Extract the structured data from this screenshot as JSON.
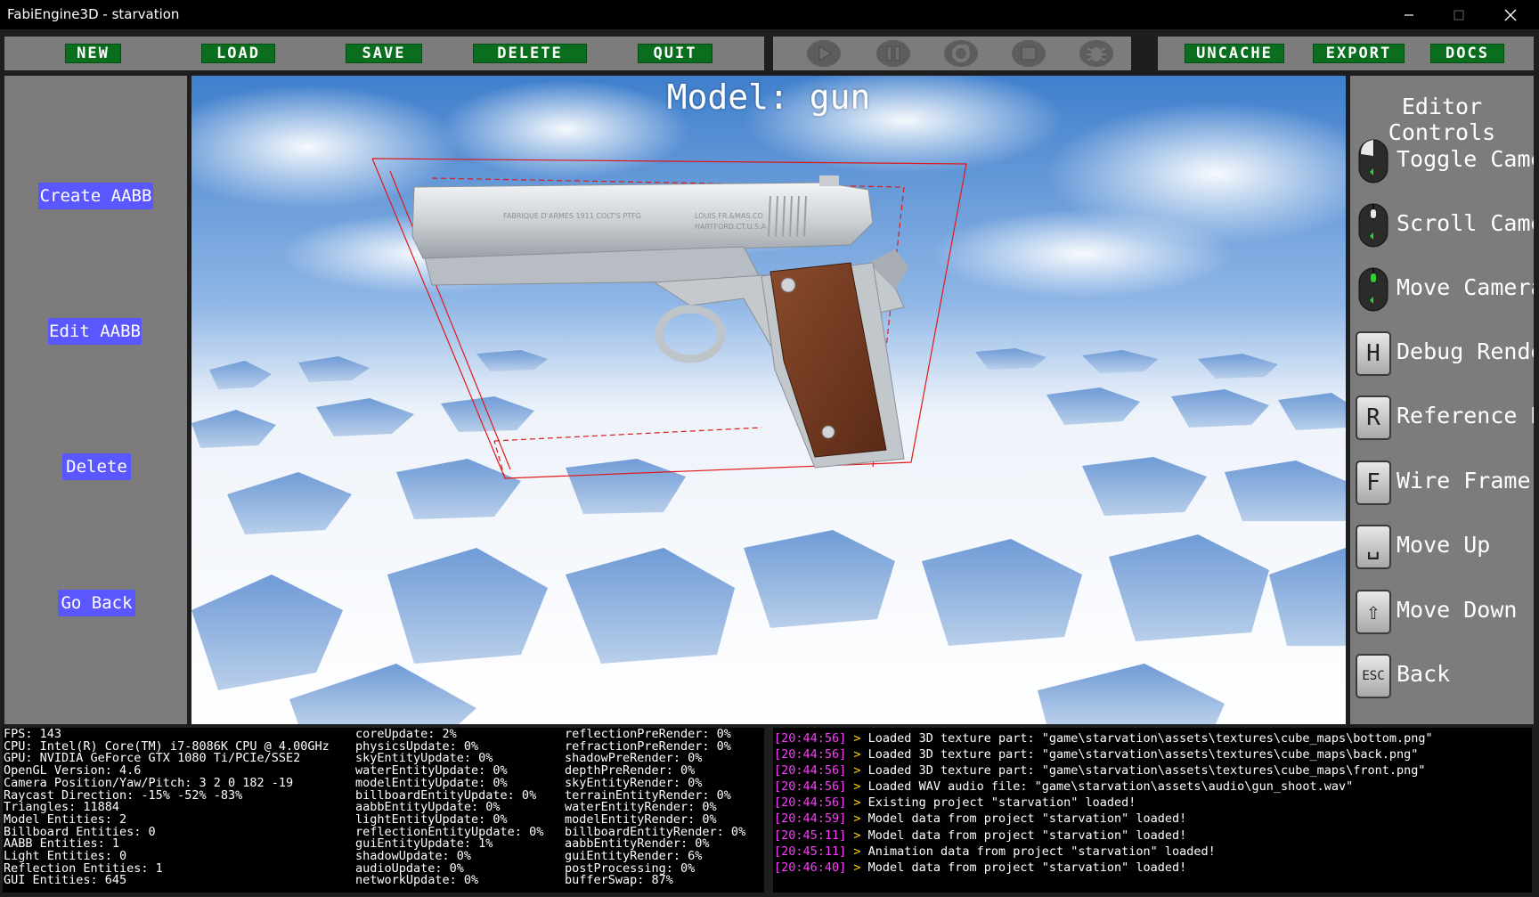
{
  "window": {
    "title": "FabiEngine3D - starvation",
    "controls": [
      "minimize-icon",
      "maximize-icon",
      "close-icon"
    ]
  },
  "menu": {
    "left": [
      "NEW",
      "LOAD",
      "SAVE",
      "DELETE",
      "QUIT"
    ],
    "playback_icons": [
      "play-icon",
      "pause-icon",
      "restart-icon",
      "stop-icon",
      "debug-bug-icon"
    ],
    "right": [
      "UNCACHE",
      "EXPORT",
      "DOCS"
    ]
  },
  "left_panel": {
    "buttons": [
      "Create AABB",
      "Edit AABB",
      "Delete",
      "Go Back"
    ]
  },
  "viewport": {
    "title": "Model: gun",
    "model_markings": [
      "FABRIQUE D'ARMES 1911 COLT'S PTFG",
      "LOUIS FR.&MAS.CO",
      "HARTFORD.CT.U.S.A"
    ]
  },
  "controls": {
    "title": "Editor Controls",
    "items": [
      {
        "icon": "mouse-left-click-icon",
        "label": "Toggle Camera"
      },
      {
        "icon": "mouse-scroll-icon",
        "label": "Scroll Camera"
      },
      {
        "icon": "mouse-middle-click-icon",
        "label": "Move Camera"
      },
      {
        "icon": "key-h-icon",
        "key": "H",
        "label": "Debug Render"
      },
      {
        "icon": "key-r-icon",
        "key": "R",
        "label": "Reference Box"
      },
      {
        "icon": "key-f-icon",
        "key": "F",
        "label": "Wire Frame"
      },
      {
        "icon": "key-space-icon",
        "key": "␣",
        "label": "Move Up"
      },
      {
        "icon": "key-shift-icon",
        "key": "⇧",
        "label": "Move Down"
      },
      {
        "icon": "key-esc-icon",
        "key": "ESC",
        "label": "Back"
      }
    ]
  },
  "stats": {
    "col1": [
      "FPS: 143",
      "CPU: Intel(R) Core(TM) i7-8086K CPU @ 4.00GHz",
      "GPU: NVIDIA GeForce GTX 1080 Ti/PCIe/SSE2",
      "OpenGL Version: 4.6",
      "Camera Position/Yaw/Pitch: 3 2 0 182 -19",
      "Raycast Direction: -15% -52% -83%",
      "Triangles: 11884",
      "Model Entities: 2",
      "Billboard Entities: 0",
      "AABB Entities: 1",
      "Light Entities: 0",
      "Reflection Entities: 1",
      "GUI Entities: 645"
    ],
    "col2": [
      "coreUpdate: 2%",
      "physicsUpdate: 0%",
      "skyEntityUpdate: 0%",
      "waterEntityUpdate: 0%",
      "modelEntityUpdate: 0%",
      "billboardEntityUpdate: 0%",
      "aabbEntityUpdate: 0%",
      "lightEntityUpdate: 0%",
      "reflectionEntityUpdate: 0%",
      "guiEntityUpdate: 1%",
      "shadowUpdate: 0%",
      "audioUpdate: 0%",
      "networkUpdate: 0%"
    ],
    "col3": [
      "reflectionPreRender: 0%",
      "refractionPreRender: 0%",
      "shadowPreRender: 0%",
      "depthPreRender: 0%",
      "skyEntityRender: 0%",
      "terrainEntityRender: 0%",
      "waterEntityRender: 0%",
      "modelEntityRender: 0%",
      "billboardEntityRender: 0%",
      "aabbEntityRender: 0%",
      "guiEntityRender: 6%",
      "postProcessing: 0%",
      "bufferSwap: 87%"
    ]
  },
  "console": [
    {
      "time": "[20:44:56]",
      "arrow": ">",
      "msg": "Loaded 3D texture part: \"game\\starvation\\assets\\textures\\cube_maps\\bottom.png\""
    },
    {
      "time": "[20:44:56]",
      "arrow": ">",
      "msg": "Loaded 3D texture part: \"game\\starvation\\assets\\textures\\cube_maps\\back.png\""
    },
    {
      "time": "[20:44:56]",
      "arrow": ">",
      "msg": "Loaded 3D texture part: \"game\\starvation\\assets\\textures\\cube_maps\\front.png\""
    },
    {
      "time": "[20:44:56]",
      "arrow": ">",
      "msg": "Loaded WAV audio file: \"game\\starvation\\assets\\audio\\gun_shoot.wav\""
    },
    {
      "time": "[20:44:56]",
      "arrow": ">",
      "msg": "Existing project \"starvation\" loaded!"
    },
    {
      "time": "[20:44:59]",
      "arrow": ">",
      "msg": "Model data from project \"starvation\" loaded!"
    },
    {
      "time": "[20:45:11]",
      "arrow": ">",
      "msg": "Model data from project \"starvation\" loaded!"
    },
    {
      "time": "[20:45:11]",
      "arrow": ">",
      "msg": "Animation data from project \"starvation\" loaded!"
    },
    {
      "time": "[20:46:40]",
      "arrow": ">",
      "msg": "Model data from project \"starvation\" loaded!"
    }
  ],
  "colors": {
    "menu_button": "#0a6e1e",
    "left_button": "#5b57ff",
    "panel_gray": "#7c7c7c",
    "console_time": "#ff3bff",
    "console_arrow": "#ffd400",
    "aabb_box": "#e01818"
  }
}
